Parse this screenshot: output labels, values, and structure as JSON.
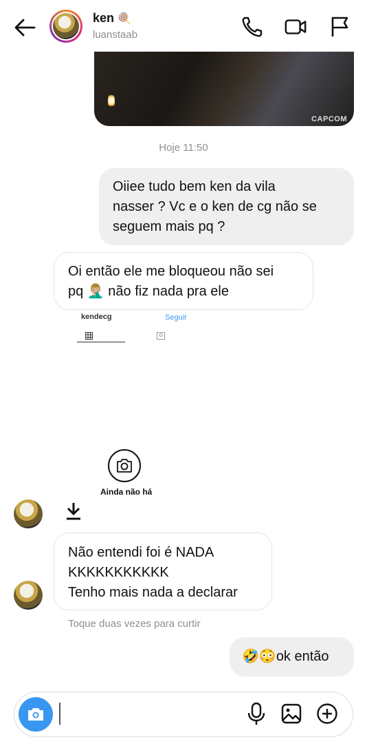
{
  "header": {
    "name": "ken",
    "name_emoji": "🍭",
    "username": "luanstaab",
    "icons": [
      "back-arrow-icon",
      "phone-icon",
      "video-camera-icon",
      "flag-icon"
    ]
  },
  "chat": {
    "media_watermark": "CAPCOM",
    "timestamp": "Hoje 11:50",
    "msg1_lines": [
      "Oiiee tudo bem ken da vila",
      "nasser ? Vc e o ken de cg não se",
      "seguem mais pq ?"
    ],
    "msg2_line1": "Oi então ele me bloqueou não sei",
    "msg2_line2_a": "pq",
    "msg2_emoji": "🤦🏼‍♂️",
    "msg2_line2_b": "não fiz nada pra ele",
    "screenshot_username": "kendecg",
    "screenshot_follow": "Seguir",
    "screenshot_empty_text": "Ainda não há",
    "msg3_lines": [
      "Não entendi foi é NADA",
      "KKKKKKKKKKK",
      "Tenho mais nada a declarar"
    ],
    "like_hint": "Toque duas vezes para curtir",
    "msg4_emojis": "🤣😳",
    "msg4_text": "ok então"
  },
  "composer": {
    "placeholder": "",
    "icons": [
      "camera-icon",
      "microphone-icon",
      "gallery-icon",
      "plus-circle-icon"
    ]
  },
  "colors": {
    "accent": "#3897f0",
    "bubble_out": "#efefef",
    "meta_text": "#8e8e8e"
  }
}
